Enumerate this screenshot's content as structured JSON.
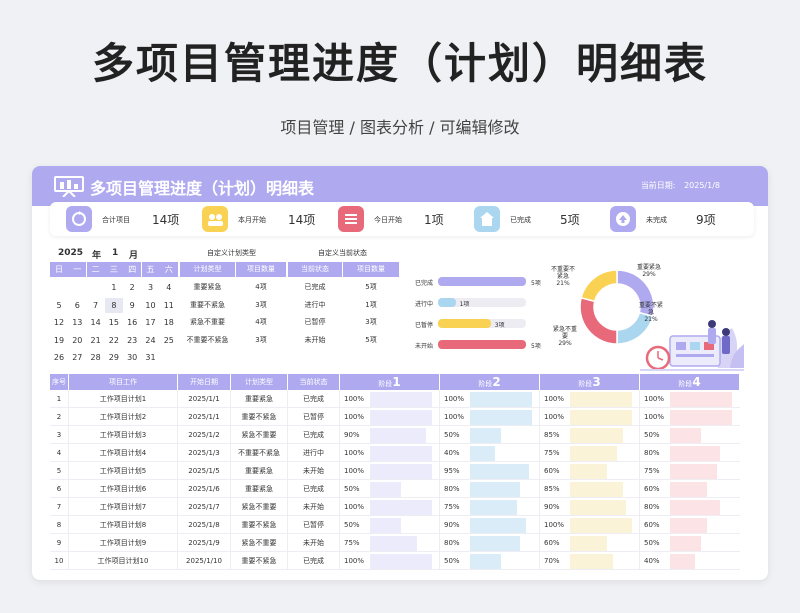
{
  "header": {
    "main_title": "多项目管理进度（计划）明细表",
    "subtitle": "项目管理 / 图表分析 / 可编辑修改"
  },
  "banner": {
    "title": "多项目管理进度（计划）明细表",
    "date_label": "当前日期:",
    "date_value": "2025/1/8",
    "icon": "presentation-board-icon"
  },
  "kpis": [
    {
      "label": "合计项目",
      "value": "14项",
      "color": "#afaaf0",
      "icon": "sync-icon"
    },
    {
      "label": "本月开始",
      "value": "14项",
      "color": "#f9d253",
      "icon": "people-icon"
    },
    {
      "label": "今日开始",
      "value": "1项",
      "color": "#e8697a",
      "icon": "list-icon"
    },
    {
      "label": "已完成",
      "value": "5项",
      "color": "#abd6f0",
      "icon": "home-icon"
    },
    {
      "label": "未完成",
      "value": "9项",
      "color": "#afaaf0",
      "icon": "upload-icon"
    }
  ],
  "calendar": {
    "year": "2025",
    "year_unit": "年",
    "month": "1",
    "month_unit": "月",
    "weekdays": [
      "日",
      "一",
      "二",
      "三",
      "四",
      "五",
      "六"
    ],
    "weeks": [
      [
        "",
        "",
        "",
        "1",
        "2",
        "3",
        "4"
      ],
      [
        "5",
        "6",
        "7",
        "8",
        "9",
        "10",
        "11"
      ],
      [
        "12",
        "13",
        "14",
        "15",
        "16",
        "17",
        "18"
      ],
      [
        "19",
        "20",
        "21",
        "22",
        "23",
        "24",
        "25"
      ],
      [
        "26",
        "27",
        "28",
        "29",
        "30",
        "31",
        ""
      ]
    ],
    "today": "8"
  },
  "type_table": {
    "section_label": "自定义计划类型",
    "headers": [
      "计划类型",
      "项目数量"
    ],
    "rows": [
      [
        "重要紧急",
        "4项"
      ],
      [
        "重要不紧急",
        "3项"
      ],
      [
        "紧急不重要",
        "4项"
      ],
      [
        "不重要不紧急",
        "3项"
      ]
    ]
  },
  "status_table": {
    "section_label": "自定义当前状态",
    "headers": [
      "当前状态",
      "项目数量"
    ],
    "rows": [
      [
        "已完成",
        "5项"
      ],
      [
        "进行中",
        "1项"
      ],
      [
        "已暂停",
        "3项"
      ],
      [
        "未开始",
        "5项"
      ]
    ]
  },
  "status_bars": [
    {
      "label": "已完成",
      "value": "5项",
      "fraction": 1.0,
      "color": "#afaaf0"
    },
    {
      "label": "进行中",
      "value": "1项",
      "fraction": 0.2,
      "color": "#abd6f0"
    },
    {
      "label": "已暂停",
      "value": "3项",
      "fraction": 0.6,
      "color": "#f9d253"
    },
    {
      "label": "未开始",
      "value": "5项",
      "fraction": 1.0,
      "color": "#e8697a"
    }
  ],
  "donut": {
    "slices": [
      {
        "label": "重要紧急",
        "percent": "29%",
        "fraction": 0.29,
        "color": "#afaaf0"
      },
      {
        "label": "重要不紧急",
        "percent": "21%",
        "fraction": 0.21,
        "color": "#abd6f0"
      },
      {
        "label": "紧急不重要",
        "percent": "29%",
        "fraction": 0.29,
        "color": "#e8697a"
      },
      {
        "label": "不重要不紧急",
        "percent": "21%",
        "fraction": 0.21,
        "color": "#f9d253"
      }
    ]
  },
  "detail": {
    "headers": [
      "序号",
      "项目工作",
      "开始日期",
      "计划类型",
      "当前状态"
    ],
    "stage_prefix": "阶段",
    "stage_numbers": [
      "1",
      "2",
      "3",
      "4"
    ],
    "stage_colors": [
      "#ecebfb",
      "#d9ecf8",
      "#fbf3d7",
      "#fbe3e6"
    ],
    "rows": [
      {
        "no": "1",
        "name": "工作项目计划1",
        "date": "2025/1/1",
        "type": "重要紧急",
        "status": "已完成",
        "stages": [
          "100%",
          "100%",
          "100%",
          "100%"
        ],
        "fractions": [
          1.0,
          1.0,
          1.0,
          1.0
        ]
      },
      {
        "no": "2",
        "name": "工作项目计划2",
        "date": "2025/1/1",
        "type": "重要不紧急",
        "status": "已暂停",
        "stages": [
          "100%",
          "100%",
          "100%",
          "100%"
        ],
        "fractions": [
          1.0,
          1.0,
          1.0,
          1.0
        ]
      },
      {
        "no": "3",
        "name": "工作项目计划3",
        "date": "2025/1/2",
        "type": "紧急不重要",
        "status": "已完成",
        "stages": [
          "90%",
          "50%",
          "85%",
          "50%"
        ],
        "fractions": [
          0.9,
          0.5,
          0.85,
          0.5
        ]
      },
      {
        "no": "4",
        "name": "工作项目计划4",
        "date": "2025/1/3",
        "type": "不重要不紧急",
        "status": "进行中",
        "stages": [
          "100%",
          "40%",
          "75%",
          "80%"
        ],
        "fractions": [
          1.0,
          0.4,
          0.75,
          0.8
        ]
      },
      {
        "no": "5",
        "name": "工作项目计划5",
        "date": "2025/1/5",
        "type": "重要紧急",
        "status": "未开始",
        "stages": [
          "100%",
          "95%",
          "60%",
          "75%"
        ],
        "fractions": [
          1.0,
          0.95,
          0.6,
          0.75
        ]
      },
      {
        "no": "6",
        "name": "工作项目计划6",
        "date": "2025/1/6",
        "type": "重要紧急",
        "status": "已完成",
        "stages": [
          "50%",
          "80%",
          "85%",
          "60%"
        ],
        "fractions": [
          0.5,
          0.8,
          0.85,
          0.6
        ]
      },
      {
        "no": "7",
        "name": "工作项目计划7",
        "date": "2025/1/7",
        "type": "紧急不重要",
        "status": "未开始",
        "stages": [
          "100%",
          "75%",
          "90%",
          "80%"
        ],
        "fractions": [
          1.0,
          0.75,
          0.9,
          0.8
        ]
      },
      {
        "no": "8",
        "name": "工作项目计划8",
        "date": "2025/1/8",
        "type": "重要不紧急",
        "status": "已暂停",
        "stages": [
          "50%",
          "90%",
          "100%",
          "60%"
        ],
        "fractions": [
          0.5,
          0.9,
          1.0,
          0.6
        ]
      },
      {
        "no": "9",
        "name": "工作项目计划9",
        "date": "2025/1/9",
        "type": "紧急不重要",
        "status": "未开始",
        "stages": [
          "75%",
          "80%",
          "60%",
          "50%"
        ],
        "fractions": [
          0.75,
          0.8,
          0.6,
          0.5
        ]
      },
      {
        "no": "10",
        "name": "工作项目计划10",
        "date": "2025/1/10",
        "type": "重要不紧急",
        "status": "已完成",
        "stages": [
          "100%",
          "50%",
          "70%",
          "40%"
        ],
        "fractions": [
          1.0,
          0.5,
          0.7,
          0.4
        ]
      }
    ]
  }
}
